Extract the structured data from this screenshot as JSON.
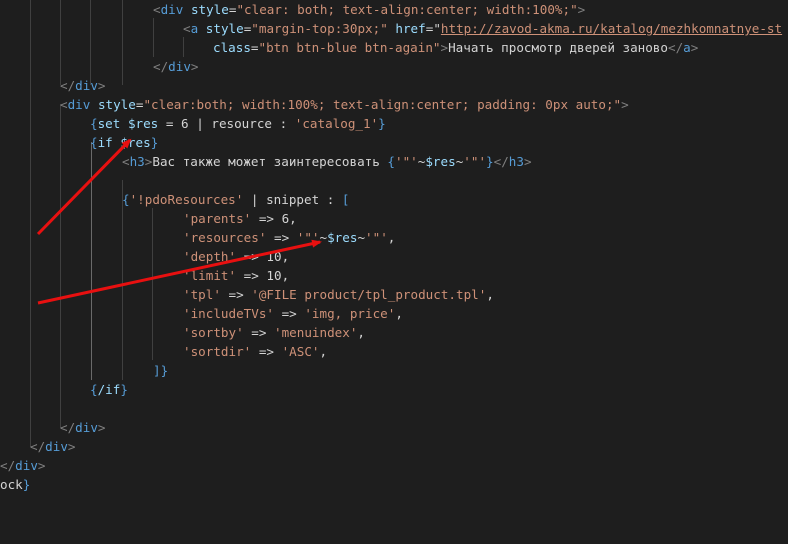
{
  "colors": {
    "background": "#1e1e1e",
    "text": "#d4d4d4",
    "tag_bracket": "#808080",
    "tag_name": "#569cd6",
    "attr_name": "#9cdcfe",
    "string": "#ce9178",
    "brace": "#da70d6",
    "link": "#ce9178",
    "annotation_arrow": "#e81010"
  },
  "code_lines": [
    {
      "indent": 153,
      "tokens": [
        {
          "t": "<",
          "c": "tag_bracket"
        },
        {
          "t": "div",
          "c": "tag_name"
        },
        {
          "t": " "
        },
        {
          "t": "style",
          "c": "attr_name"
        },
        {
          "t": "="
        },
        {
          "t": "\"clear: both; text-align:center; width:100%;\"",
          "c": "string"
        },
        {
          "t": ">",
          "c": "tag_bracket"
        }
      ]
    },
    {
      "indent": 183,
      "tokens": [
        {
          "t": "<",
          "c": "tag_bracket"
        },
        {
          "t": "a",
          "c": "tag_name"
        },
        {
          "t": " "
        },
        {
          "t": "style",
          "c": "attr_name"
        },
        {
          "t": "="
        },
        {
          "t": "\"margin-top:30px;\"",
          "c": "string"
        },
        {
          "t": " "
        },
        {
          "t": "href",
          "c": "attr_name"
        },
        {
          "t": "="
        },
        {
          "t": "\""
        },
        {
          "t": "http://zavod-akma.ru/katalog/mezhkomnatnye-st",
          "c": "link",
          "u": true
        }
      ]
    },
    {
      "indent": 213,
      "tokens": [
        {
          "t": "class",
          "c": "attr_name"
        },
        {
          "t": "="
        },
        {
          "t": "\"btn btn-blue btn-again\"",
          "c": "string"
        },
        {
          "t": ">",
          "c": "tag_bracket"
        },
        {
          "t": "Начать просмотр дверей заново"
        },
        {
          "t": "</",
          "c": "tag_bracket"
        },
        {
          "t": "a",
          "c": "tag_name"
        },
        {
          "t": ">",
          "c": "tag_bracket"
        }
      ]
    },
    {
      "indent": 153,
      "tokens": [
        {
          "t": "</",
          "c": "tag_bracket"
        },
        {
          "t": "div",
          "c": "tag_name"
        },
        {
          "t": ">",
          "c": "tag_bracket"
        }
      ]
    },
    {
      "indent": 60,
      "tokens": [
        {
          "t": "</",
          "c": "tag_bracket"
        },
        {
          "t": "div",
          "c": "tag_name"
        },
        {
          "t": ">",
          "c": "tag_bracket"
        }
      ]
    },
    {
      "indent": 60,
      "tokens": [
        {
          "t": "<",
          "c": "tag_bracket"
        },
        {
          "t": "div",
          "c": "tag_name"
        },
        {
          "t": " "
        },
        {
          "t": "style",
          "c": "attr_name"
        },
        {
          "t": "="
        },
        {
          "t": "\"clear:both; width:100%; text-align:center; padding: 0px auto;\"",
          "c": "string"
        },
        {
          "t": ">",
          "c": "tag_bracket"
        }
      ]
    },
    {
      "indent": 90,
      "tokens": [
        {
          "t": "{",
          "c": "tag_name"
        },
        {
          "t": "set ",
          "c": "attr_name"
        },
        {
          "t": "$res",
          "c": "attr_name"
        },
        {
          "t": " = 6 | resource : "
        },
        {
          "t": "'catalog_1'",
          "c": "string"
        },
        {
          "t": "}",
          "c": "tag_name"
        }
      ]
    },
    {
      "indent": 90,
      "tokens": [
        {
          "t": "{",
          "c": "tag_name"
        },
        {
          "t": "if ",
          "c": "attr_name"
        },
        {
          "t": "$res",
          "c": "attr_name"
        },
        {
          "t": "}",
          "c": "tag_name"
        }
      ]
    },
    {
      "indent": 122,
      "tokens": [
        {
          "t": "<",
          "c": "tag_bracket"
        },
        {
          "t": "h3",
          "c": "tag_name"
        },
        {
          "t": ">",
          "c": "tag_bracket"
        },
        {
          "t": "Вас также может заинтересовать "
        },
        {
          "t": "{",
          "c": "tag_name"
        },
        {
          "t": "'\"'",
          "c": "string"
        },
        {
          "t": "~"
        },
        {
          "t": "$res",
          "c": "attr_name"
        },
        {
          "t": "~"
        },
        {
          "t": "'\"'",
          "c": "string"
        },
        {
          "t": "}",
          "c": "tag_name"
        },
        {
          "t": "</",
          "c": "tag_bracket"
        },
        {
          "t": "h3",
          "c": "tag_name"
        },
        {
          "t": ">",
          "c": "tag_bracket"
        }
      ]
    },
    {
      "indent": 0,
      "tokens": []
    },
    {
      "indent": 122,
      "tokens": [
        {
          "t": "{",
          "c": "tag_name"
        },
        {
          "t": "'!pdoResources'",
          "c": "string"
        },
        {
          "t": " | snippet : "
        },
        {
          "t": "[",
          "c": "tag_name"
        }
      ]
    },
    {
      "indent": 183,
      "tokens": [
        {
          "t": "'parents'",
          "c": "string"
        },
        {
          "t": " => 6,"
        }
      ]
    },
    {
      "indent": 183,
      "tokens": [
        {
          "t": "'resources'",
          "c": "string"
        },
        {
          "t": " => "
        },
        {
          "t": "'\"'",
          "c": "string"
        },
        {
          "t": "~"
        },
        {
          "t": "$res",
          "c": "attr_name"
        },
        {
          "t": "~"
        },
        {
          "t": "'\"'",
          "c": "string"
        },
        {
          "t": ","
        }
      ]
    },
    {
      "indent": 183,
      "tokens": [
        {
          "t": "'depth'",
          "c": "string"
        },
        {
          "t": " => 10,"
        }
      ]
    },
    {
      "indent": 183,
      "tokens": [
        {
          "t": "'limit'",
          "c": "string"
        },
        {
          "t": " => 10,"
        }
      ]
    },
    {
      "indent": 183,
      "tokens": [
        {
          "t": "'tpl'",
          "c": "string"
        },
        {
          "t": " => "
        },
        {
          "t": "'@FILE product/tpl_product.tpl'",
          "c": "string"
        },
        {
          "t": ","
        }
      ]
    },
    {
      "indent": 183,
      "tokens": [
        {
          "t": "'includeTVs'",
          "c": "string"
        },
        {
          "t": " => "
        },
        {
          "t": "'img, price'",
          "c": "string"
        },
        {
          "t": ","
        }
      ]
    },
    {
      "indent": 183,
      "tokens": [
        {
          "t": "'sortby'",
          "c": "string"
        },
        {
          "t": " => "
        },
        {
          "t": "'menuindex'",
          "c": "string"
        },
        {
          "t": ","
        }
      ]
    },
    {
      "indent": 183,
      "tokens": [
        {
          "t": "'sortdir'",
          "c": "string"
        },
        {
          "t": " => "
        },
        {
          "t": "'ASC'",
          "c": "string"
        },
        {
          "t": ","
        }
      ]
    },
    {
      "indent": 153,
      "tokens": [
        {
          "t": "]",
          "c": "tag_name"
        },
        {
          "t": "}",
          "c": "tag_name"
        }
      ]
    },
    {
      "indent": 90,
      "tokens": [
        {
          "t": "{",
          "c": "tag_name"
        },
        {
          "t": "/if",
          "c": "attr_name"
        },
        {
          "t": "}",
          "c": "tag_name"
        }
      ]
    },
    {
      "indent": 0,
      "tokens": []
    },
    {
      "indent": 60,
      "tokens": [
        {
          "t": "</",
          "c": "tag_bracket"
        },
        {
          "t": "div",
          "c": "tag_name"
        },
        {
          "t": ">",
          "c": "tag_bracket"
        }
      ]
    },
    {
      "indent": 30,
      "tokens": [
        {
          "t": "</",
          "c": "tag_bracket"
        },
        {
          "t": "div",
          "c": "tag_name"
        },
        {
          "t": ">",
          "c": "tag_bracket"
        }
      ]
    },
    {
      "indent": 0,
      "tokens": [
        {
          "t": "</",
          "c": "tag_bracket"
        },
        {
          "t": "div",
          "c": "tag_name"
        },
        {
          "t": ">",
          "c": "tag_bracket"
        }
      ]
    },
    {
      "indent": 0,
      "tokens": [
        {
          "t": "ock"
        },
        {
          "t": "}",
          "c": "tag_name"
        }
      ]
    }
  ]
}
